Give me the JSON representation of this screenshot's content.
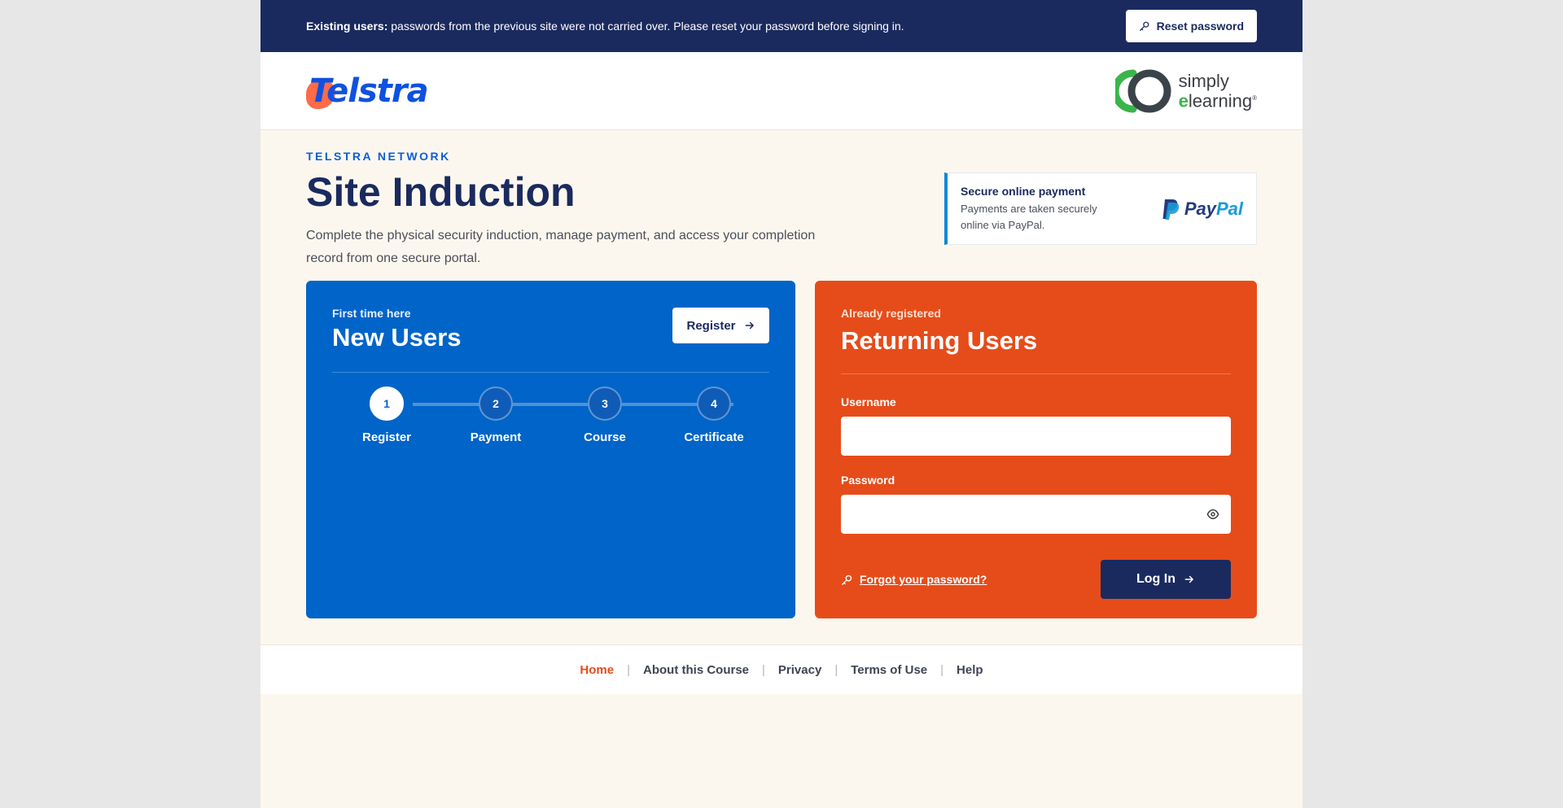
{
  "notice": {
    "lead": "Existing users:",
    "text": "passwords from the previous site were not carried over. Please reset your password before signing in.",
    "reset_label": "Reset password",
    "icon": "key-icon"
  },
  "header": {
    "brand": "Telstra",
    "partner_line1": "simply",
    "partner_line2_e": "e",
    "partner_line2_rest": "learning",
    "partner_mark": "®"
  },
  "hero": {
    "eyebrow": "TELSTRA NETWORK",
    "title": "Site Induction",
    "lead": "Complete the physical security induction, manage payment, and access your completion record from one secure portal."
  },
  "payment": {
    "title": "Secure online payment",
    "text": "Payments are taken securely online via PayPal.",
    "brand_a": "Pay",
    "brand_b": "Pal"
  },
  "new_users": {
    "kicker": "First time here",
    "title": "New Users",
    "register_label": "Register",
    "steps": [
      {
        "num": "1",
        "label": "Register",
        "active": true
      },
      {
        "num": "2",
        "label": "Payment",
        "active": false
      },
      {
        "num": "3",
        "label": "Course",
        "active": false
      },
      {
        "num": "4",
        "label": "Certificate",
        "active": false
      }
    ]
  },
  "returning_users": {
    "kicker": "Already registered",
    "title": "Returning Users",
    "username_label": "Username",
    "username_value": "",
    "password_label": "Password",
    "password_value": "",
    "forgot_label": "Forgot your password?",
    "login_label": "Log In"
  },
  "footer": {
    "links": [
      "Home",
      "About this Course",
      "Privacy",
      "Terms of Use",
      "Help"
    ],
    "active": "Home"
  },
  "colors": {
    "navy": "#1b2a5e",
    "blue": "#0064c8",
    "orange": "#e64c1a",
    "cream": "#fcf7ee"
  }
}
